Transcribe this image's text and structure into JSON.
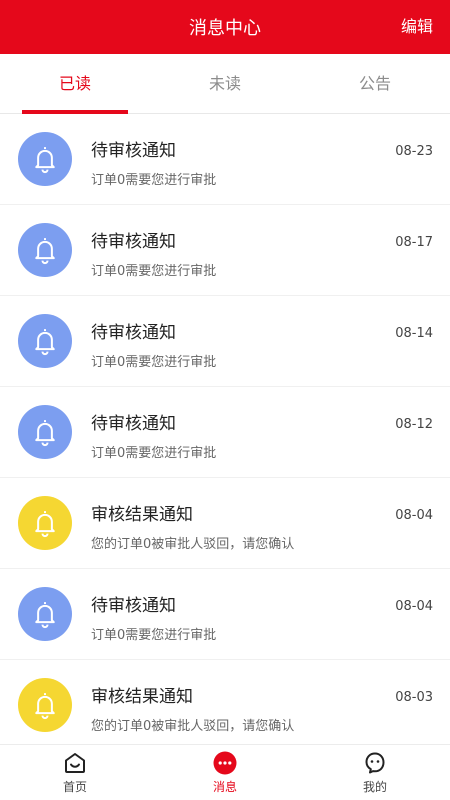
{
  "header": {
    "title": "消息中心",
    "edit_label": "编辑"
  },
  "tabs": [
    {
      "label": "已读",
      "active": true
    },
    {
      "label": "未读",
      "active": false
    },
    {
      "label": "公告",
      "active": false
    }
  ],
  "messages": [
    {
      "title": "待审核通知",
      "desc": "订单0需要您进行审批",
      "date": "08-23",
      "icon": "bell-icon",
      "color": "#7c9ef0"
    },
    {
      "title": "待审核通知",
      "desc": "订单0需要您进行审批",
      "date": "08-17",
      "icon": "bell-icon",
      "color": "#7c9ef0"
    },
    {
      "title": "待审核通知",
      "desc": "订单0需要您进行审批",
      "date": "08-14",
      "icon": "bell-icon",
      "color": "#7c9ef0"
    },
    {
      "title": "待审核通知",
      "desc": "订单0需要您进行审批",
      "date": "08-12",
      "icon": "bell-icon",
      "color": "#7c9ef0"
    },
    {
      "title": "审核结果通知",
      "desc": "您的订单0被审批人驳回，请您确认",
      "date": "08-04",
      "icon": "bell-icon",
      "color": "#f5d732"
    },
    {
      "title": "待审核通知",
      "desc": "订单0需要您进行审批",
      "date": "08-04",
      "icon": "bell-icon",
      "color": "#7c9ef0"
    },
    {
      "title": "审核结果通知",
      "desc": "您的订单0被审批人驳回，请您确认",
      "date": "08-03",
      "icon": "bell-icon",
      "color": "#f5d732"
    }
  ],
  "tabbar": [
    {
      "label": "首页",
      "icon": "home-icon",
      "active": false
    },
    {
      "label": "消息",
      "icon": "message-icon",
      "active": true
    },
    {
      "label": "我的",
      "icon": "profile-icon",
      "active": false
    }
  ],
  "colors": {
    "brand": "#e5081b",
    "unread_blue": "#7c9ef0",
    "result_yellow": "#f5d732"
  }
}
